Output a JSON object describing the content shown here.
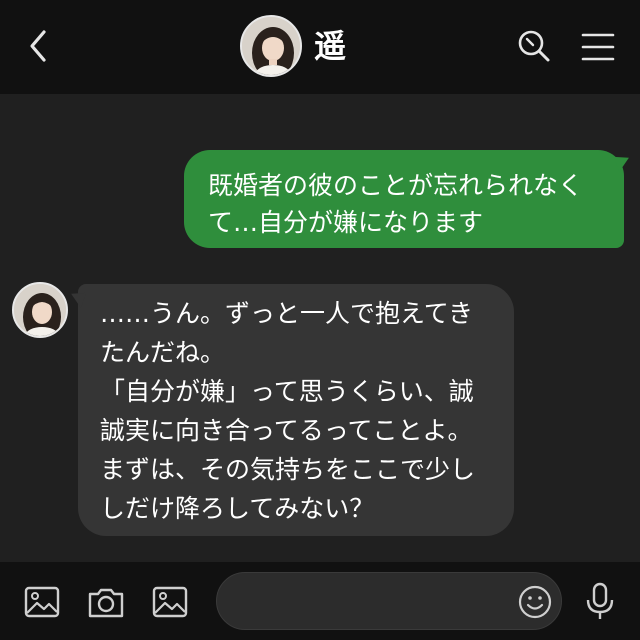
{
  "header": {
    "contact_name": "遥",
    "icons": {
      "back": "chevron-left-icon",
      "search": "search-icon",
      "menu": "hamburger-menu-icon"
    }
  },
  "messages": [
    {
      "direction": "outgoing",
      "lines": [
        "既婚者の彼のことが忘れられなく",
        "て…自分が嫌になります"
      ]
    },
    {
      "direction": "incoming",
      "lines": [
        "……うん。ずっと一人で抱えてき",
        "たんだね。",
        "「自分が嫌」って思うくらい、誠",
        "誠実に向き合ってるってことよ。",
        "まずは、その気持ちをここで少し",
        "しだけ降ろしてみない？"
      ]
    }
  ],
  "composer": {
    "input_value": "",
    "icons": [
      "image-icon",
      "camera-icon",
      "image-icon",
      "emoji-icon",
      "microphone-icon"
    ]
  },
  "colors": {
    "header_bg": "#111111",
    "chat_bg": "#202020",
    "outgoing_bubble": "#2f8e3c",
    "incoming_bubble": "#353535",
    "text": "#ffffff",
    "icon": "#cfcfcf"
  }
}
